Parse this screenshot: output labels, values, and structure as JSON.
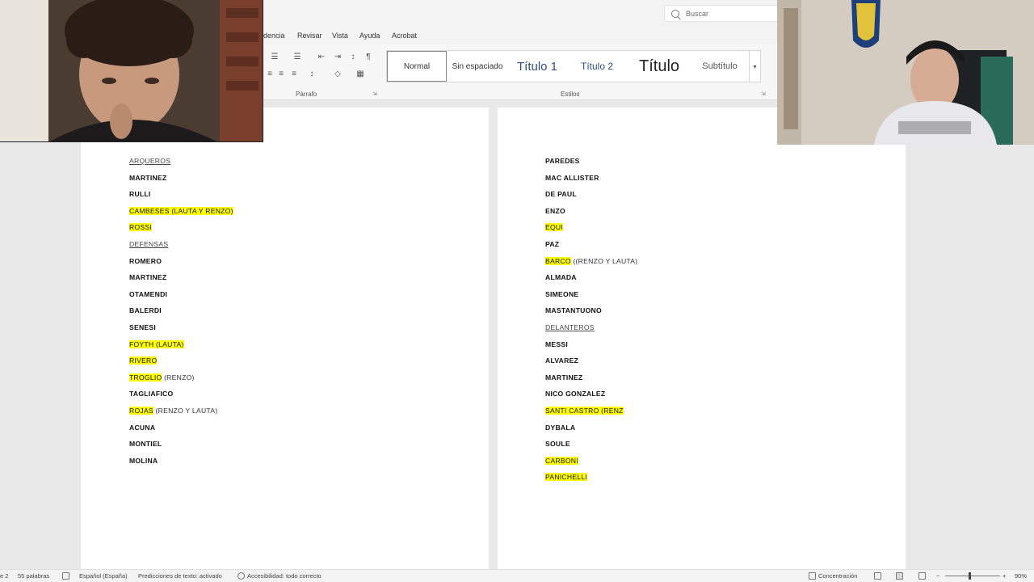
{
  "search": {
    "placeholder": "Buscar"
  },
  "menu": {
    "items": [
      "dencia",
      "Revisar",
      "Vista",
      "Ayuda",
      "Acrobat"
    ]
  },
  "ribbon": {
    "paragraph_label": "Párrafo",
    "styles_label": "Estilos",
    "styles": [
      "Normal",
      "Sin espaciado",
      "Título 1",
      "Título 2",
      "Título",
      "Subtítulo"
    ]
  },
  "document": {
    "left": [
      {
        "text": "ARQUEROS",
        "kind": "heading"
      },
      {
        "text": "MARTINEZ",
        "kind": "name"
      },
      {
        "text": "RULLI",
        "kind": "name"
      },
      {
        "text": "CAMBESES (LAUTA Y RENZO)",
        "kind": "highlight"
      },
      {
        "text": "ROSSI",
        "kind": "highlight"
      },
      {
        "text": "DEFENSAS",
        "kind": "heading"
      },
      {
        "text": "ROMERO",
        "kind": "name"
      },
      {
        "text": "MARTINEZ",
        "kind": "name"
      },
      {
        "text": "OTAMENDI",
        "kind": "name"
      },
      {
        "text": "BALERDI",
        "kind": "name"
      },
      {
        "text": "SENESI",
        "kind": "name"
      },
      {
        "text": "FOYTH (LAUTA)",
        "kind": "highlight"
      },
      {
        "text": "RIVERO",
        "kind": "highlight"
      },
      {
        "text": "TROGLIO",
        "kind": "highlight",
        "note": " (RENZO)"
      },
      {
        "text": "TAGLIAFICO",
        "kind": "name"
      },
      {
        "text": "ROJAS",
        "kind": "highlight",
        "note": " (RENZO Y LAUTA)"
      },
      {
        "text": "ACUNA",
        "kind": "name"
      },
      {
        "text": "MONTIEL",
        "kind": "name"
      },
      {
        "text": "MOLINA",
        "kind": "name"
      }
    ],
    "right": [
      {
        "text": "PAREDES",
        "kind": "name"
      },
      {
        "text": "MAC ALLISTER",
        "kind": "name"
      },
      {
        "text": "DE PAUL",
        "kind": "name"
      },
      {
        "text": "ENZO",
        "kind": "name"
      },
      {
        "text": "EQUI",
        "kind": "highlight"
      },
      {
        "text": "PAZ",
        "kind": "name"
      },
      {
        "text": "BARCO",
        "kind": "highlight",
        "note": " ((RENZO Y LAUTA)"
      },
      {
        "text": "ALMADA",
        "kind": "name"
      },
      {
        "text": "SIMEONE",
        "kind": "name"
      },
      {
        "text": "MASTANTUONO",
        "kind": "name"
      },
      {
        "text": "DELANTEROS",
        "kind": "heading"
      },
      {
        "text": "MESSI",
        "kind": "name"
      },
      {
        "text": "ALVAREZ",
        "kind": "name"
      },
      {
        "text": "MARTINEZ",
        "kind": "name"
      },
      {
        "text": "NICO GONZALEZ",
        "kind": "name"
      },
      {
        "text": "SANTI CASTRO  (RENZ",
        "kind": "highlight"
      },
      {
        "text": "DYBALA",
        "kind": "name"
      },
      {
        "text": "SOULE",
        "kind": "name"
      },
      {
        "text": "CARBONI",
        "kind": "highlight"
      },
      {
        "text": "PANICHELLI",
        "kind": "highlight"
      }
    ]
  },
  "statusbar": {
    "page": "e 2",
    "words": "55 palabras",
    "language": "Español (España)",
    "predictions": "Predicciones de texto: activado",
    "accessibility": "Accesibilidad: todo correcto",
    "focus": "Concentración",
    "zoom": "90%"
  },
  "colors": {
    "highlight": "#ffff00",
    "ribbon_bg": "#f3f3f3",
    "canvas_bg": "#e9e9e9"
  }
}
